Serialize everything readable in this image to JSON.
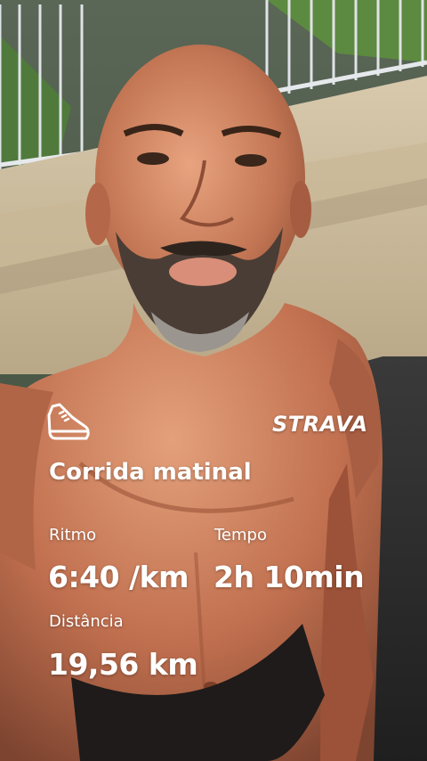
{
  "activity": {
    "title": "Corrida matinal",
    "brand": "STRAVA",
    "icon": "running-shoe-icon"
  },
  "stats": {
    "pace_label": "Ritmo",
    "pace_value": "6:40 /km",
    "time_label": "Tempo",
    "time_value": "2h 10min",
    "distance_label": "Distância",
    "distance_value": "19,56 km"
  }
}
